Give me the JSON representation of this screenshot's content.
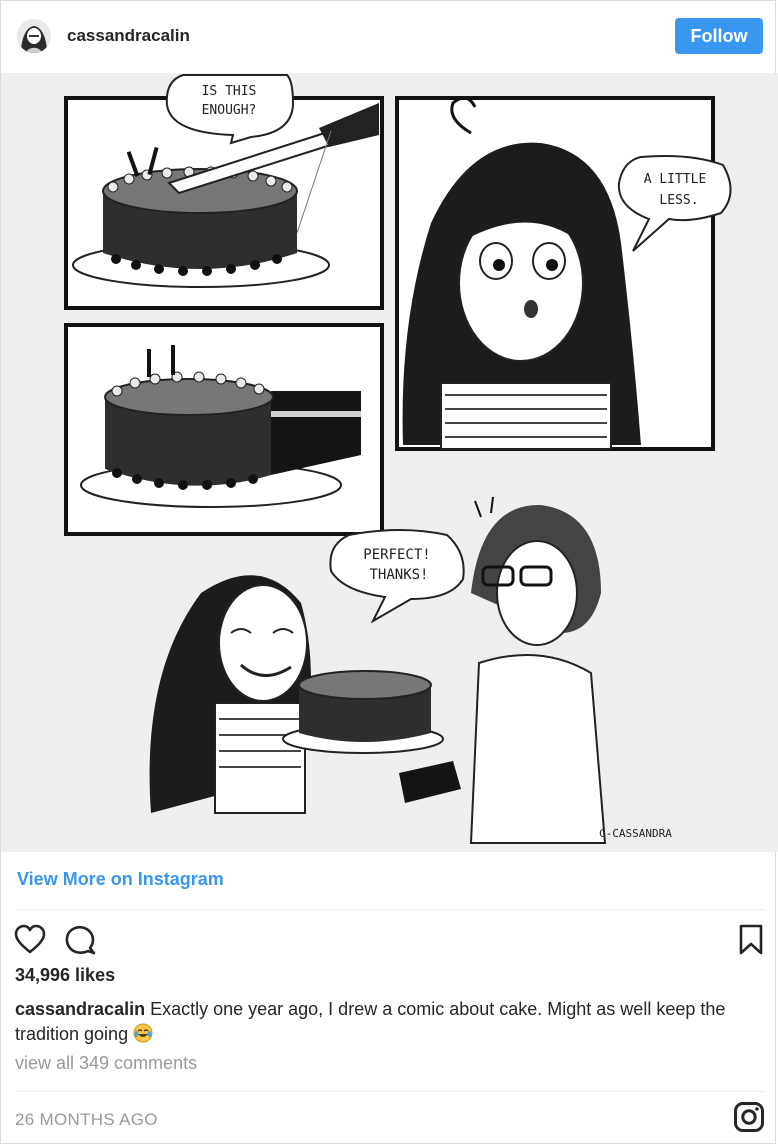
{
  "header": {
    "username": "cassandracalin",
    "follow_label": "Follow"
  },
  "comic": {
    "bubble_1_line_1": "IS THIS",
    "bubble_1_line_2": "ENOUGH?",
    "bubble_2_line_1": "A LITTLE",
    "bubble_2_line_2": "LESS.",
    "bubble_3_line_1": "PERFECT!",
    "bubble_3_line_2": "THANKS!",
    "signature": "C-CASSANDRA"
  },
  "links": {
    "view_more": "View More on Instagram",
    "view_comments": "view all 349 comments"
  },
  "post": {
    "likes": "34,996 likes",
    "caption_user": "cassandracalin",
    "caption_text": " Exactly one year ago, I drew a comic about cake. Might as well keep the tradition going ",
    "timestamp": "26 MONTHS AGO"
  },
  "icons": {
    "avatar": "avatar",
    "like": "heart-icon",
    "comment": "comment-icon",
    "save": "bookmark-icon",
    "emoji": "laughing-tears-emoji",
    "brand": "instagram-icon"
  },
  "colors": {
    "accent": "#3897f0",
    "text": "#262626",
    "muted": "#999999",
    "comic_background": "#efefef"
  }
}
